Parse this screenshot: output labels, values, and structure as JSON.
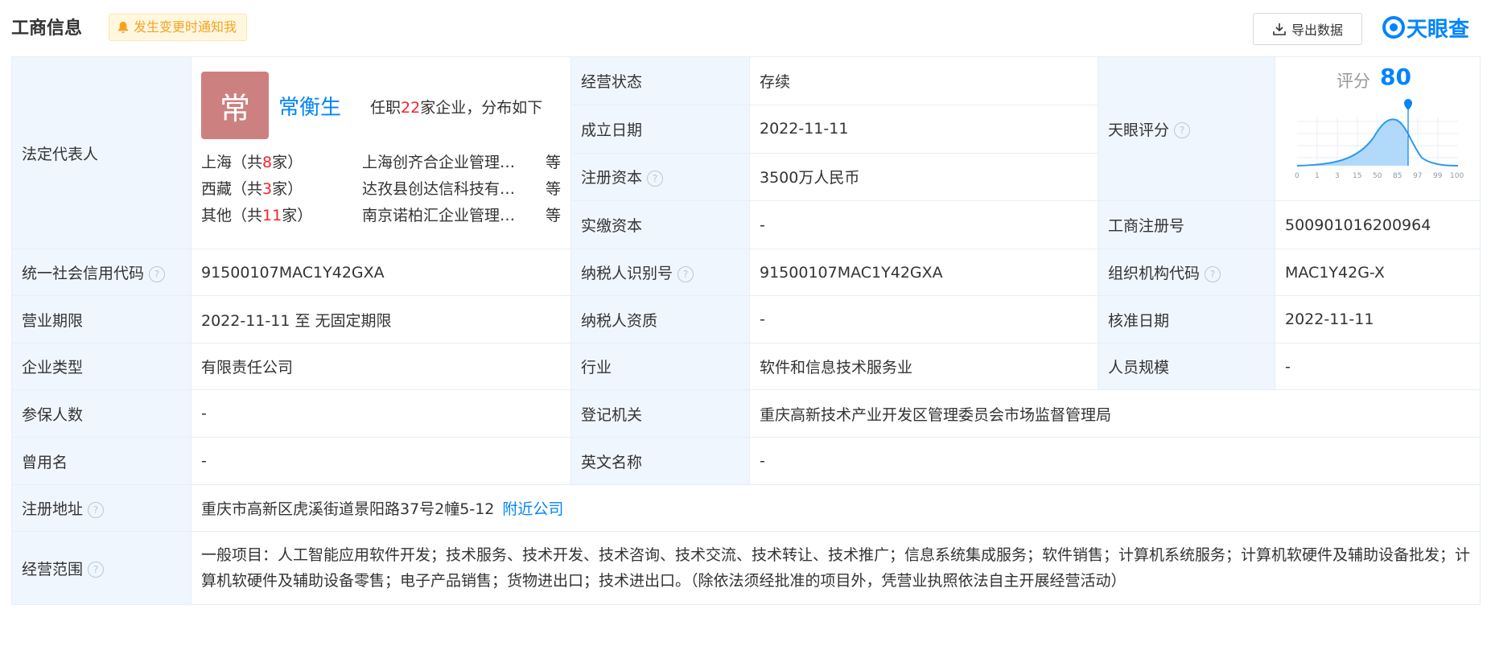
{
  "header": {
    "title": "工商信息",
    "notify_label": "发生变更时通知我",
    "export_label": "导出数据",
    "logo_text": "天眼查"
  },
  "colors": {
    "accent": "#0084ff",
    "label_bg": "#f0f6fd",
    "warn": "#f4a321",
    "red": "#f5222d",
    "avatar_bg": "#cd8080"
  },
  "legal_rep": {
    "label": "法定代表人",
    "avatar_char": "常",
    "name": "常衡生",
    "desc_pre": "任职",
    "count": "22",
    "desc_post": "家企业，分布如下",
    "regions": [
      {
        "pre": "上海（共",
        "count": "8",
        "post": "家）",
        "company": "上海创齐合企业管理…",
        "more": "等"
      },
      {
        "pre": "西藏（共",
        "count": "3",
        "post": "家）",
        "company": "达孜县创达信科技有…",
        "more": "等"
      },
      {
        "pre": "其他（共",
        "count": "11",
        "post": "家）",
        "company": "南京诺柏汇企业管理…",
        "more": "等"
      }
    ]
  },
  "fields": {
    "status_label": "经营状态",
    "status": "存续",
    "founded_label": "成立日期",
    "founded": "2022-11-11",
    "reg_capital_label": "注册资本",
    "reg_capital": "3500万人民币",
    "paid_capital_label": "实缴资本",
    "paid_capital": "-",
    "tianyan_score_label": "天眼评分",
    "reg_no_label": "工商注册号",
    "reg_no": "500901016200964",
    "credit_code_label": "统一社会信用代码",
    "credit_code": "91500107MAC1Y42GXA",
    "taxpayer_id_label": "纳税人识别号",
    "taxpayer_id": "91500107MAC1Y42GXA",
    "org_code_label": "组织机构代码",
    "org_code": "MAC1Y42G-X",
    "term_label": "营业期限",
    "term": "2022-11-11 至 无固定期限",
    "taxpayer_qual_label": "纳税人资质",
    "taxpayer_qual": "-",
    "approve_label": "核准日期",
    "approve": "2022-11-11",
    "type_label": "企业类型",
    "type": "有限责任公司",
    "industry_label": "行业",
    "industry": "软件和信息技术服务业",
    "staff_label": "人员规模",
    "staff": "-",
    "insured_label": "参保人数",
    "insured": "-",
    "authority_label": "登记机关",
    "authority": "重庆高新技术产业开发区管理委员会市场监督管理局",
    "former_name_label": "曾用名",
    "former_name": "-",
    "english_label": "英文名称",
    "english": "-",
    "address_label": "注册地址",
    "address": "重庆市高新区虎溪街道景阳路37号2幢5-12",
    "nearby_link": "附近公司",
    "scope_label": "经营范围",
    "scope": "一般项目：人工智能应用软件开发；技术服务、技术开发、技术咨询、技术交流、技术转让、技术推广；信息系统集成服务；软件销售；计算机系统服务；计算机软硬件及辅助设备批发；计算机软硬件及辅助设备零售；电子产品销售；货物进出口；技术进出口。（除依法须经批准的项目外，凭营业执照依法自主开展经营活动）"
  },
  "score": {
    "title": "评分",
    "value": "80",
    "ticks": [
      "0",
      "1",
      "3",
      "15",
      "50",
      "85",
      "97",
      "99",
      "100"
    ]
  }
}
